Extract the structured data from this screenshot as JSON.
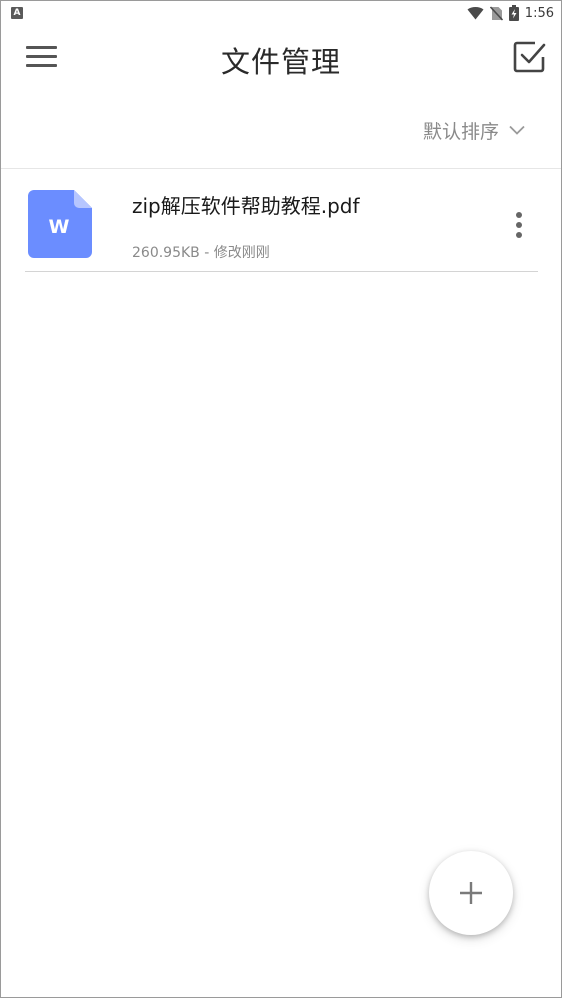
{
  "status_bar": {
    "left_icon": "A",
    "time": "1:56",
    "icons": [
      "wifi-icon",
      "no-sim-icon",
      "battery-charging-icon"
    ]
  },
  "toolbar": {
    "title": "文件管理",
    "menu_icon": "hamburger-menu-icon",
    "select_icon": "checkbox-select-icon"
  },
  "sort": {
    "label": "默认排序",
    "icon": "chevron-down-icon"
  },
  "files": [
    {
      "name": "zip解压软件帮助教程.pdf",
      "meta": "260.95KB - 修改刚刚",
      "icon_letter": "W",
      "icon_color": "#6b8dff"
    }
  ],
  "fab": {
    "icon": "plus-icon"
  },
  "colors": {
    "accent_blue": "#6b8dff",
    "title_text": "#2a2a2a",
    "secondary_text": "#8a8a8a"
  }
}
